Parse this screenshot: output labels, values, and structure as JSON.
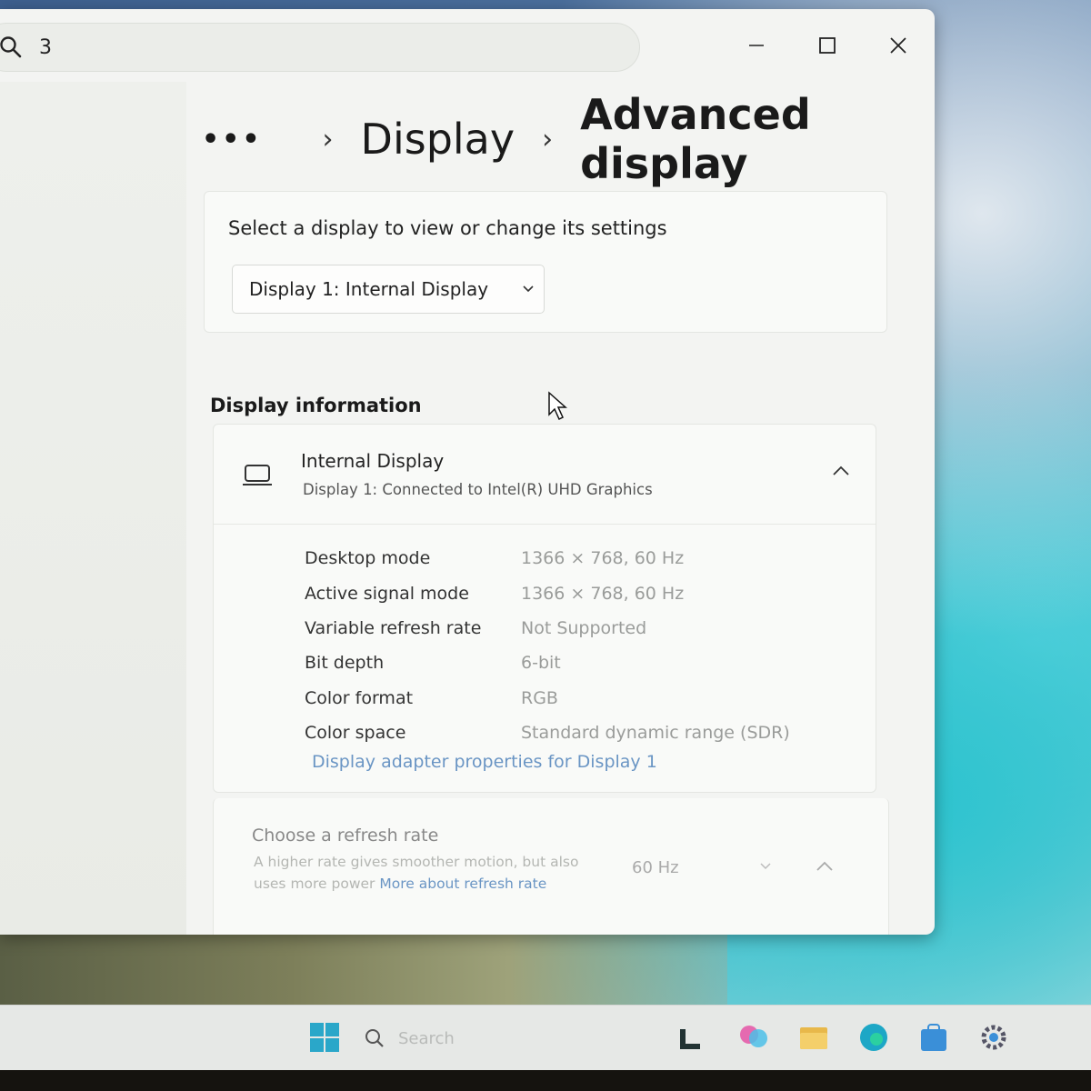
{
  "search": {
    "value": "3"
  },
  "window_controls": {
    "minimize": "minimize-icon",
    "maximize": "maximize-icon",
    "close": "close-icon"
  },
  "breadcrumb": {
    "overflow": "•••",
    "items": [
      "Display",
      "Advanced display"
    ]
  },
  "select_display": {
    "label": "Select a display to view or change its settings",
    "selected": "Display 1: Internal Display"
  },
  "display_information": {
    "section_title": "Display information",
    "device_name": "Internal Display",
    "device_subtitle": "Display 1: Connected to Intel(R) UHD Graphics",
    "properties": [
      {
        "key": "Desktop mode",
        "value": "1366 × 768, 60 Hz"
      },
      {
        "key": "Active signal mode",
        "value": "1366 × 768, 60 Hz"
      },
      {
        "key": "Variable refresh rate",
        "value": "Not Supported"
      },
      {
        "key": "Bit depth",
        "value": "6-bit"
      },
      {
        "key": "Color format",
        "value": "RGB"
      },
      {
        "key": "Color space",
        "value": "Standard dynamic range (SDR)"
      }
    ],
    "adapter_link": "Display adapter properties for Display 1"
  },
  "refresh_rate": {
    "title": "Choose a refresh rate",
    "description": "A higher rate gives smoother motion, but also uses more power",
    "more_link": "More about refresh rate",
    "selected": "60 Hz"
  },
  "taskbar": {
    "search_placeholder": "Search",
    "icons": [
      "windows-start-icon",
      "task-view-icon",
      "copilot-icon",
      "file-explorer-icon",
      "edge-icon",
      "store-icon",
      "settings-icon"
    ]
  },
  "colors": {
    "accent_link": "#6a95c4",
    "window_bg": "#f3f4f2"
  }
}
